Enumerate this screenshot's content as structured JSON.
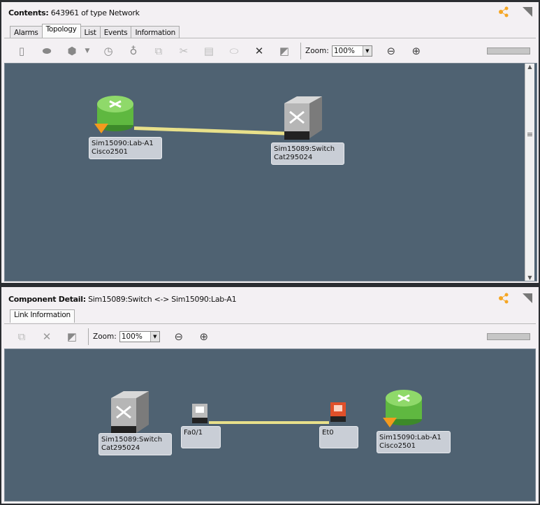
{
  "top": {
    "title_label": "Contents:",
    "title_value": "643961 of type Network",
    "tabs": [
      "Alarms",
      "Topology",
      "List",
      "Events",
      "Information"
    ],
    "active_tab": "Topology",
    "zoom_label": "Zoom:",
    "zoom_value": "100%",
    "nodes": [
      {
        "name": "Sim15090:Lab-A1",
        "type": "Cisco2501"
      },
      {
        "name": "Sim15089:Switch",
        "type": "Cat295024"
      }
    ]
  },
  "bottom": {
    "title_label": "Component Detail:",
    "title_value": "Sim15089:Switch <-> Sim15090:Lab-A1",
    "tabs": [
      "Link Information"
    ],
    "zoom_label": "Zoom:",
    "zoom_value": "100%",
    "nodes": [
      {
        "name": "Sim15089:Switch",
        "type": "Cat295024"
      },
      {
        "name": "Fa0/1"
      },
      {
        "name": "Et0"
      },
      {
        "name": "Sim15090:Lab-A1",
        "type": "Cisco2501"
      }
    ]
  },
  "colors": {
    "canvas": "#4f6272",
    "link": "#e8e08a",
    "router": "#6cc24a",
    "alarm": "#f39a1e",
    "port_alarm": "#e0502a"
  }
}
